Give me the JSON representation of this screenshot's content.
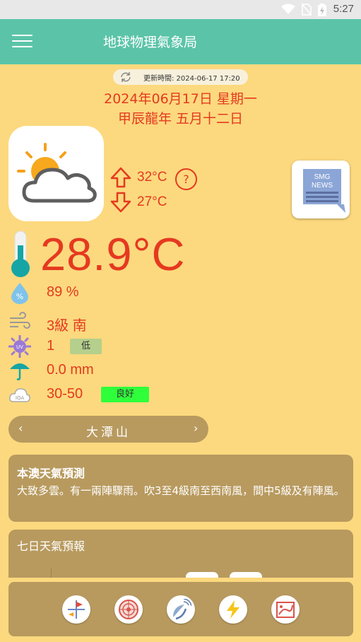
{
  "status_bar": {
    "time": "5:27"
  },
  "app_bar": {
    "title": "地球物理氣象局"
  },
  "update": {
    "text": "更新時間: 2024-06-17 17:20"
  },
  "date": {
    "gregorian": "2024年06月17日 星期一",
    "lunar": "甲辰龍年 五月十二日"
  },
  "forecast_temps": {
    "high": "32°C",
    "low": "27°C",
    "help": "?"
  },
  "smg_news": {
    "line1": "SMG",
    "line2": "NEWS"
  },
  "current": {
    "temperature": "28.9°C",
    "humidity": "89 %",
    "wind": "3級 南",
    "uv_index": "1",
    "uv_level": "低",
    "rainfall": "0.0 mm",
    "aqi": "30-50",
    "aqi_level": "良好"
  },
  "colors": {
    "uv_badge": "#b5cf8c",
    "aqi_badge": "#2fff3a",
    "accent": "#e53920",
    "card": "#b89a5f",
    "header": "#5bc4a8"
  },
  "location": {
    "name": "大潭山",
    "prev": "‹",
    "next": "›"
  },
  "local_forecast": {
    "title": "本澳天氣預測",
    "text": "大致多雲。有一兩陣驟雨。吹3至4級南至西南風，間中5級及有陣風。"
  },
  "seven_day": {
    "title": "七日天氣預報"
  },
  "bottom_nav": [
    "wind-vane-icon",
    "radar-icon",
    "satellite-icon",
    "lightning-icon",
    "typhoon-map-icon"
  ]
}
